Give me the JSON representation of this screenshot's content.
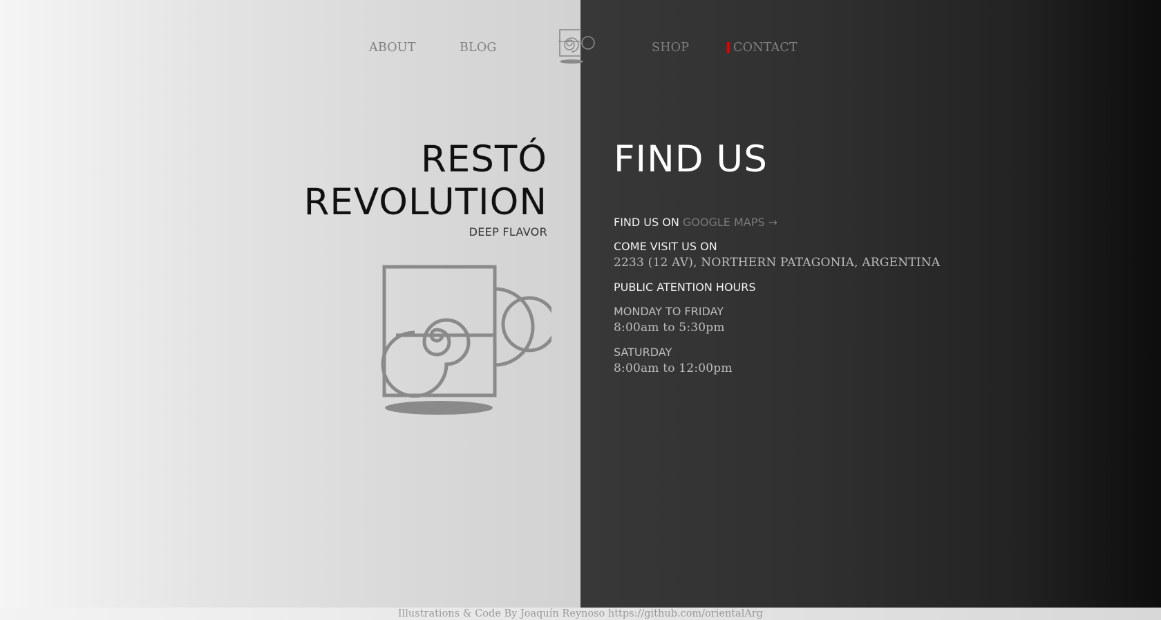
{
  "nav": {
    "about": "ABOUT",
    "blog": "BLOG",
    "shop": "SHOP",
    "contact": "CONTACT",
    "logo_icon": "spiral-mug-icon",
    "active_marker_color": "#e00000"
  },
  "brand": {
    "title_line1": "RESTÓ",
    "title_line2": "REVOLUTION",
    "tagline": "DEEP FLAVOR",
    "logo_icon": "spiral-mug-icon"
  },
  "find_us": {
    "title": "FIND US",
    "maps_prefix": "FIND US ON",
    "maps_link": "GOOGLE MAPS →",
    "visit_label": "COME VISIT US ON",
    "address": "2233 (12 AV), NORTHERN PATAGONIA, ARGENTINA",
    "hours_label": "PUBLIC ATENTION HOURS",
    "weekday_label": "MONDAY TO FRIDAY",
    "weekday_hours": "8:00am to 5:30pm",
    "saturday_label": "SATURDAY",
    "saturday_hours": "8:00am to 12:00pm"
  },
  "footer": {
    "credit": "Illustrations & Code By Joaquín Reynoso https://github.com/orientalArg"
  },
  "colors": {
    "left_panel": "#e0e0e0",
    "right_panel": "#2a2a2a",
    "accent": "#e00000",
    "logo_gray": "#8a8a8a"
  }
}
